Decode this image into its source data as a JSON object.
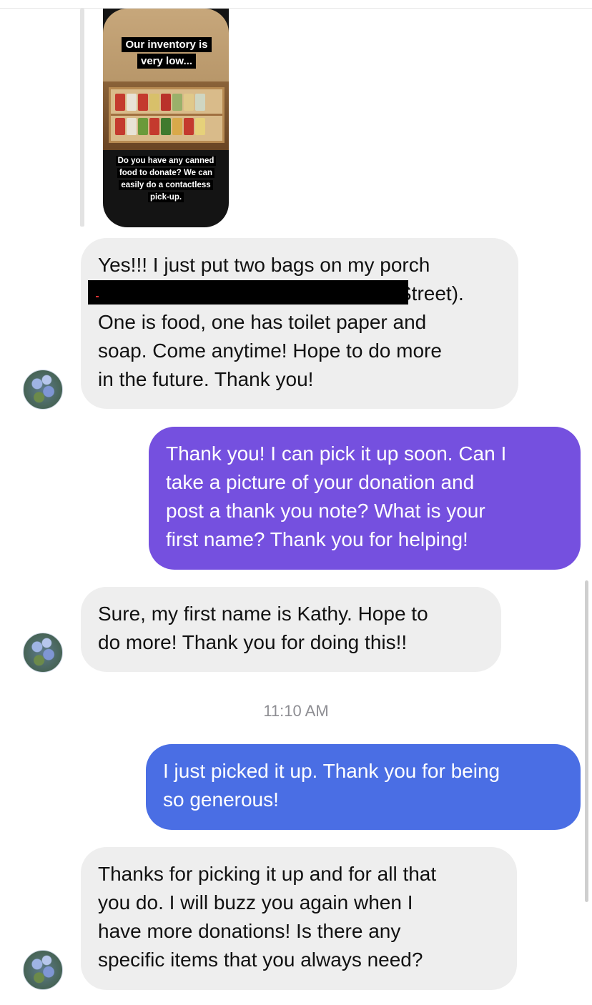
{
  "story": {
    "caption_top": "Our inventory is very low...",
    "caption_bottom": "Do you have any canned food to donate? We can easily do a contactless pick-up."
  },
  "messages": [
    {
      "from": "them",
      "lines": [
        "Yes!!! I just put two bags on my porch",
        "Street).",
        "One is food, one has toilet paper and",
        "soap. Come anytime! Hope to do more",
        "in the future. Thank you!"
      ]
    },
    {
      "from": "me",
      "lines": [
        "Thank you! I can pick it up soon. Can I",
        "take a picture of your donation and",
        "post a thank you note? What is your",
        "first name? Thank you for helping!"
      ]
    },
    {
      "from": "them",
      "lines": [
        "Sure, my first name is Kathy. Hope to",
        "do more! Thank you for doing this!!"
      ]
    },
    {
      "from": "me",
      "lines": [
        "I just picked it up. Thank you for being",
        "so generous!"
      ]
    },
    {
      "from": "them",
      "lines": [
        "Thanks for picking it up and for all that",
        "you do. I will buzz you again when I",
        "have more donations! Is there any",
        "specific items that you always need?"
      ]
    }
  ],
  "timestamp": "11:10 AM",
  "colors": {
    "received_bubble": "#eeeeee",
    "sent_bubble_purple": "#7b4fe0",
    "sent_bubble_blue": "#4a6fe4"
  },
  "icons": {
    "avatar": "contact-avatar-flowers"
  }
}
